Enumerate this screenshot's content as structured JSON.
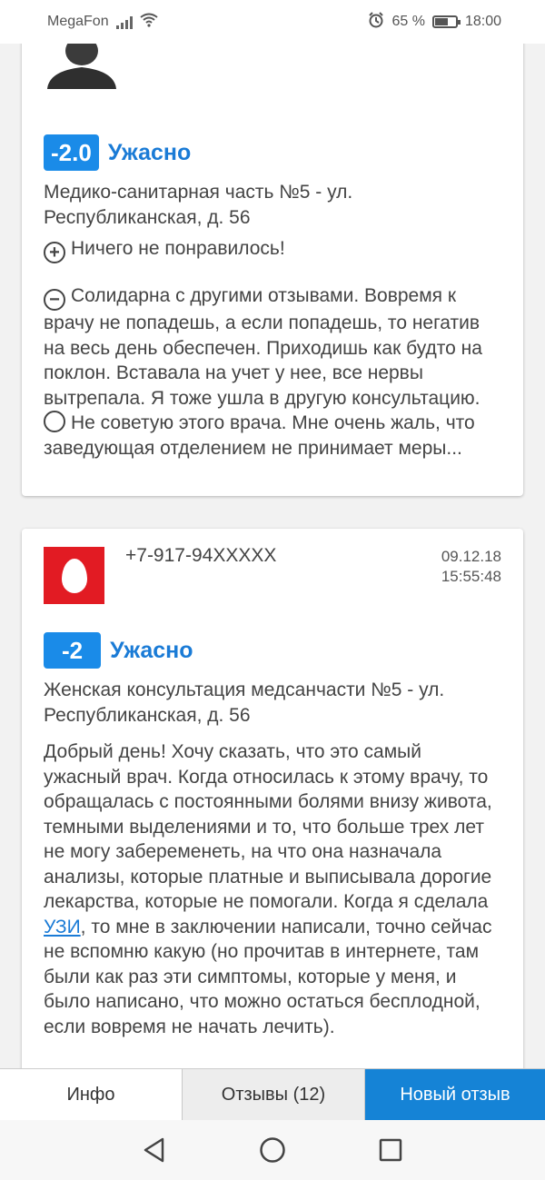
{
  "status_bar": {
    "carrier": "MegaFon",
    "battery": "65 %",
    "battery_level": 0.65,
    "time": "18:00"
  },
  "reviews": [
    {
      "rating": "-2.0",
      "rating_label": "Ужасно",
      "place": "Медико-санитарная часть №5 - ул. Республиканская, д. 56",
      "pros": "Ничего не понравилось!",
      "cons": "Солидарна с другими отзывами. Вовремя к врачу не попадешь, а если попадешь, то негатив на весь день обеспечен. Приходишь как будто на поклон. Вставала на учет у нее, все нервы вытрепала. Я тоже ушла в другую консультацию.",
      "comment": "Не советую этого врача. Мне очень жаль, что заведующая отделением не принимает меры..."
    },
    {
      "author": "+7-917-94XXXXX",
      "date": "09.12.18",
      "time": "15:55:48",
      "rating": "-2",
      "rating_label": "Ужасно",
      "place": "Женская консультация медсанчасти №5 - ул. Республиканская, д. 56",
      "text_before_link": "Добрый день! Хочу сказать, что это самый ужасный врач. Когда относилась к этому врачу, то обращалась с постоянными болями внизу живота, темными выделениями и то, что больше трех лет не могу забеременеть, на что она назначала анализы, которые платные и выписывала дорогие лекарства, которые не помогали. Когда я сделала ",
      "link_text": "УЗИ",
      "text_after_link": ", то мне в заключении написали, точно сейчас не вспомню какую (но прочитав в интернете, там были как раз эти симптомы, которые у меня, и было написано, что можно остаться бесплодной, если вовремя не начать лечить)."
    }
  ],
  "tabs": {
    "info": "Инфо",
    "reviews": "Отзывы (12)",
    "new_review": "Новый отзыв"
  },
  "colors": {
    "accent": "#1a8be8",
    "link": "#1a7bd6",
    "operator_logo": "#e21b23"
  }
}
